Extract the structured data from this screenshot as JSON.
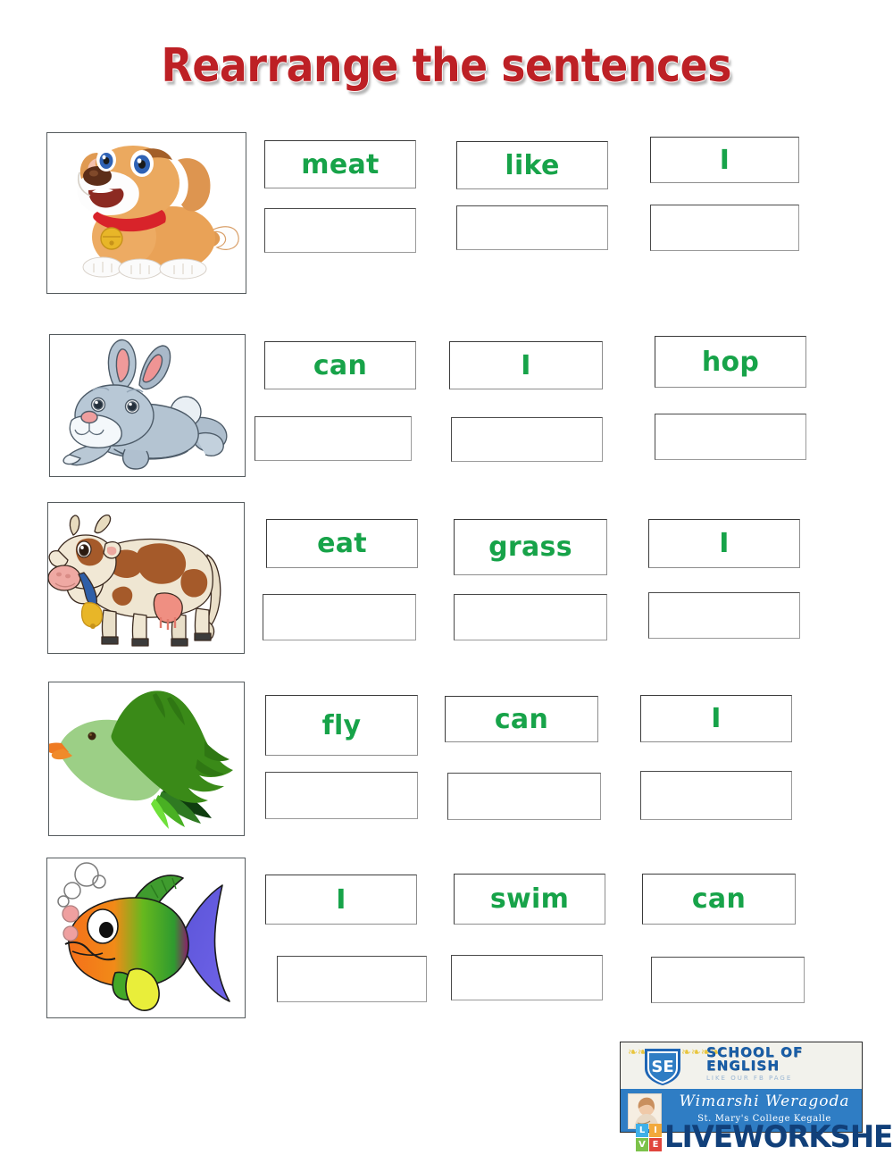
{
  "page": {
    "title": "Rearrange the sentences",
    "title_color": "#bd2025",
    "word_color": "#17a349",
    "background": "#ffffff"
  },
  "rows": [
    {
      "animal": "dog",
      "picture_name": "dog-picture",
      "words": [
        "meat",
        "like",
        "I"
      ],
      "answers": [
        "",
        "",
        ""
      ]
    },
    {
      "animal": "rabbit",
      "picture_name": "rabbit-picture",
      "words": [
        "can",
        "I",
        "hop"
      ],
      "answers": [
        "",
        "",
        ""
      ]
    },
    {
      "animal": "cow",
      "picture_name": "cow-picture",
      "words": [
        "eat",
        "grass",
        "I"
      ],
      "answers": [
        "",
        "",
        ""
      ]
    },
    {
      "animal": "bird",
      "picture_name": "bird-picture",
      "words": [
        "fly",
        "can",
        "I"
      ],
      "answers": [
        "",
        "",
        ""
      ]
    },
    {
      "animal": "fish",
      "picture_name": "fish-picture",
      "words": [
        "I",
        "swim",
        "can"
      ],
      "answers": [
        "",
        "",
        ""
      ]
    }
  ],
  "footer": {
    "logo": {
      "shield_text": "SE",
      "school_line1": "SCHOOL OF",
      "school_line2": "ENGLISH",
      "tagline": "LIKE OUR FB PAGE",
      "teacher_name": "Wimarshi Weragoda",
      "institution": "St. Mary's College Kegalle"
    },
    "liveworksheets": {
      "icon_letters": [
        "L",
        "I",
        "V",
        "E"
      ],
      "wordmark": "LIVEWORKSHEETS"
    }
  }
}
